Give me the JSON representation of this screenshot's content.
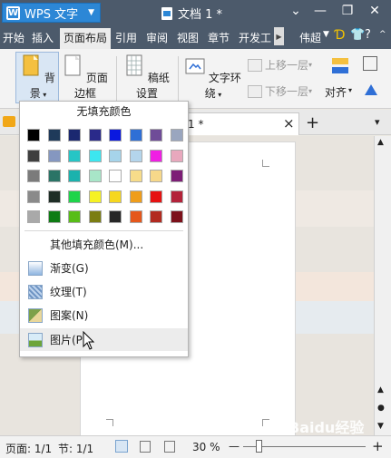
{
  "titlebar": {
    "app_button": "WPS 文字",
    "doc_title": "文档 1 *",
    "controls": [
      "⌄",
      "—",
      "❐",
      "✕"
    ]
  },
  "menubar": {
    "items": [
      "开始",
      "插入",
      "页面布局",
      "引用",
      "审阅",
      "视图",
      "章节",
      "开发工"
    ],
    "active": "页面布局",
    "right_user": "伟超"
  },
  "ribbon": {
    "background_label": "背景",
    "page_border_label": "页面边框",
    "paper_setting_label": "稿纸设置",
    "text_wrap_label": "文字环绕",
    "move_up_label": "上移一层",
    "move_down_label": "下移一层",
    "align_label": "对齐"
  },
  "tabbar": {
    "doc_tab_label": "1 *",
    "close": "×",
    "add": "+"
  },
  "dropdown": {
    "no_fill_label": "无填充颜色",
    "swatches": [
      [
        "#000000",
        "#1f3a5a",
        "#1b2870",
        "#2a2a8a",
        "#0a18e0",
        "#2f6fd6",
        "#6f4c98",
        "#9aa6bf"
      ],
      [
        "#3f3f3f",
        "#8597c0",
        "#26c5c5",
        "#3ce6ef",
        "#a6d4ea",
        "#b4d5ec",
        "#f01fe3",
        "#e8a8bd"
      ],
      [
        "#7b7b7b",
        "#2a7466",
        "#1bb2ad",
        "#a8e6c8",
        "#ffffff",
        "#f7dc8a",
        "#f7d88a",
        "#7d1e76"
      ],
      [
        "#8a8a8a",
        "#1e2e26",
        "#1fd44a",
        "#f6f223",
        "#f6d71e",
        "#ef9d1b",
        "#e61212",
        "#b3233a"
      ],
      [
        "#a9a9a9",
        "#0e7c14",
        "#57bd17",
        "#7b7d12",
        "#272727",
        "#e5571b",
        "#b22a20",
        "#7c101a"
      ]
    ],
    "more_colors_label": "其他填充颜色(M)...",
    "gradient_label": "渐变(G)",
    "texture_label": "纹理(T)",
    "pattern_label": "图案(N)",
    "picture_label": "图片(P)"
  },
  "statusbar": {
    "page_info": "页面: 1/1",
    "section_info": "节: 1/1",
    "zoom": "30 %",
    "zoom_minus": "—",
    "zoom_plus": "+"
  },
  "colors": {
    "titlebar_bg": "#4c5a6b",
    "accent_blue": "#2c87d6"
  },
  "watermark": "Baidu经验"
}
